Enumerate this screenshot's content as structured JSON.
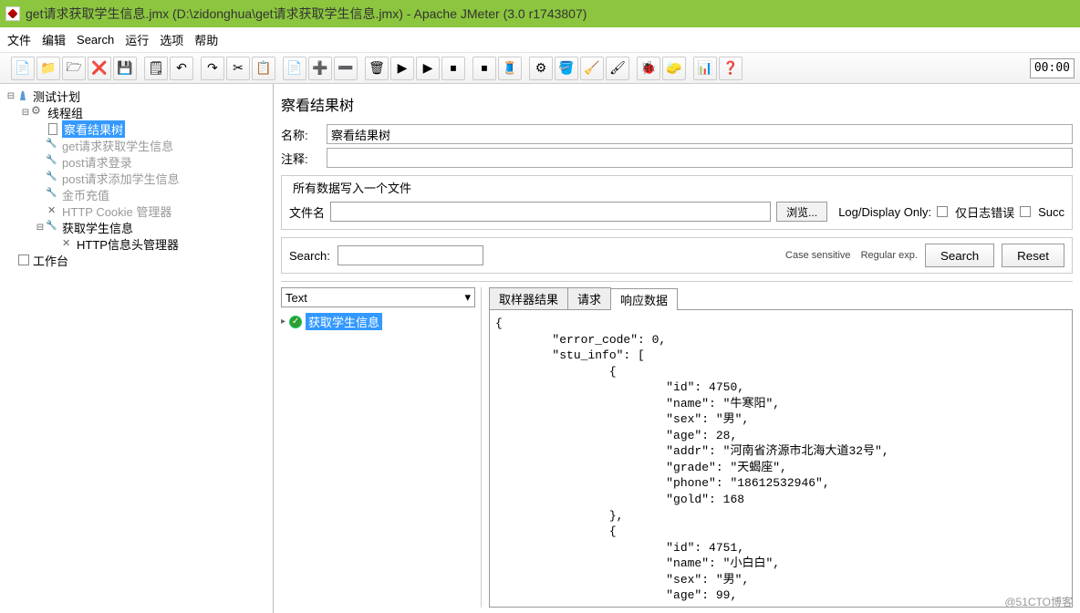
{
  "window": {
    "title": "get请求获取学生信息.jmx (D:\\zidonghua\\get请求获取学生信息.jmx) - Apache JMeter (3.0 r1743807)"
  },
  "menubar": {
    "items": [
      "文件",
      "编辑",
      "Search",
      "运行",
      "选项",
      "帮助"
    ]
  },
  "toolbar": {
    "buttons": [
      "📄",
      "📁",
      "🗁",
      "❌",
      "💾",
      "🗒",
      "↶",
      "↷",
      "✂",
      "📋",
      "📄",
      "➕",
      "➖",
      "🗑",
      "▶",
      "▶",
      "⏹",
      "⏹",
      "🧵",
      "⚙",
      "🪣",
      "🧹",
      "🖌",
      "🐞",
      "🧽",
      "📊",
      "❓"
    ],
    "timer": "00:00"
  },
  "tree": {
    "items": [
      {
        "indent": 0,
        "expand": "⊟",
        "icon": "flask",
        "label": "测试计划"
      },
      {
        "indent": 1,
        "expand": "⊟",
        "icon": "gear",
        "label": "线程组"
      },
      {
        "indent": 2,
        "expand": "",
        "icon": "doc",
        "label": "察看结果树",
        "selected": true
      },
      {
        "indent": 2,
        "expand": "",
        "icon": "wrench",
        "label": "get请求获取学生信息",
        "light": true
      },
      {
        "indent": 2,
        "expand": "",
        "icon": "wrench",
        "label": "post请求登录",
        "light": true
      },
      {
        "indent": 2,
        "expand": "",
        "icon": "wrench",
        "label": "post请求添加学生信息",
        "light": true
      },
      {
        "indent": 2,
        "expand": "",
        "icon": "wrench",
        "label": "金币充值",
        "light": true
      },
      {
        "indent": 2,
        "expand": "",
        "icon": "x",
        "label": "HTTP Cookie 管理器",
        "light": true
      },
      {
        "indent": 2,
        "expand": "⊟",
        "icon": "wrench",
        "label": "获取学生信息"
      },
      {
        "indent": 3,
        "expand": "",
        "icon": "x",
        "label": "HTTP信息头管理器"
      },
      {
        "indent": 0,
        "expand": "",
        "icon": "n",
        "label": "工作台"
      }
    ]
  },
  "main": {
    "heading": "察看结果树",
    "name_label": "名称:",
    "name_value": "察看结果树",
    "comment_label": "注释:",
    "comment_value": "",
    "allwrites_label": "所有数据写入一个文件",
    "filename_label": "文件名",
    "browse": "浏览...",
    "logdisplay_label": "Log/Display Only:",
    "only_errors": "仅日志错误",
    "success": "Succ",
    "search_label": "Search:",
    "case_sensitive": "Case sensitive",
    "regex": "Regular exp.",
    "search_btn": "Search",
    "reset_btn": "Reset",
    "renderer": "Text",
    "result_item": "获取学生信息",
    "tabs": {
      "sampler": "取样器结果",
      "request": "请求",
      "response": "响应数据"
    },
    "response_body": "{\n        \"error_code\": 0,\n        \"stu_info\": [\n                {\n                        \"id\": 4750,\n                        \"name\": \"牛寒阳\",\n                        \"sex\": \"男\",\n                        \"age\": 28,\n                        \"addr\": \"河南省济源市北海大道32号\",\n                        \"grade\": \"天蝎座\",\n                        \"phone\": \"18612532946\",\n                        \"gold\": 168\n                },\n                {\n                        \"id\": 4751,\n                        \"name\": \"小白白\",\n                        \"sex\": \"男\",\n                        \"age\": 99,"
  },
  "watermark": "@51CTO博客"
}
